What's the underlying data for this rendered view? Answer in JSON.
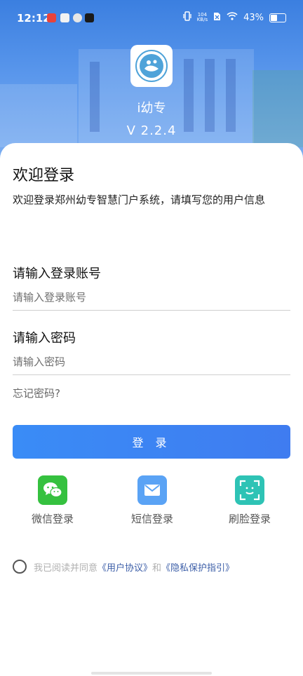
{
  "status_bar": {
    "time": "12:12",
    "net_speed_value": "104",
    "net_speed_unit": "KB/s",
    "battery": "43%"
  },
  "app": {
    "name": "i幼专",
    "version": "V  2.2.4"
  },
  "login": {
    "title": "欢迎登录",
    "subtitle": "欢迎登录郑州幼专智慧门户系统，请填写您的用户信息",
    "account_label": "请输入登录账号",
    "account_placeholder": "请输入登录账号",
    "account_value": "",
    "password_label": "请输入密码",
    "password_placeholder": "请输入密码",
    "password_value": "",
    "forgot": "忘记密码?",
    "submit": "登 录"
  },
  "alt_logins": [
    {
      "label": "微信登录",
      "icon": "wechat-icon",
      "color": "#35c13f"
    },
    {
      "label": "短信登录",
      "icon": "sms-icon",
      "color": "#5aa3f5"
    },
    {
      "label": "刷脸登录",
      "icon": "face-scan-icon",
      "color": "#2ec3b5"
    }
  ],
  "agreement": {
    "prefix": "我已阅读并同意",
    "user_agreement": "《用户协议》",
    "and": "和",
    "privacy_policy": "《隐私保护指引》"
  },
  "colors": {
    "primary": "#3a86f4",
    "link": "#3d5fa8"
  }
}
